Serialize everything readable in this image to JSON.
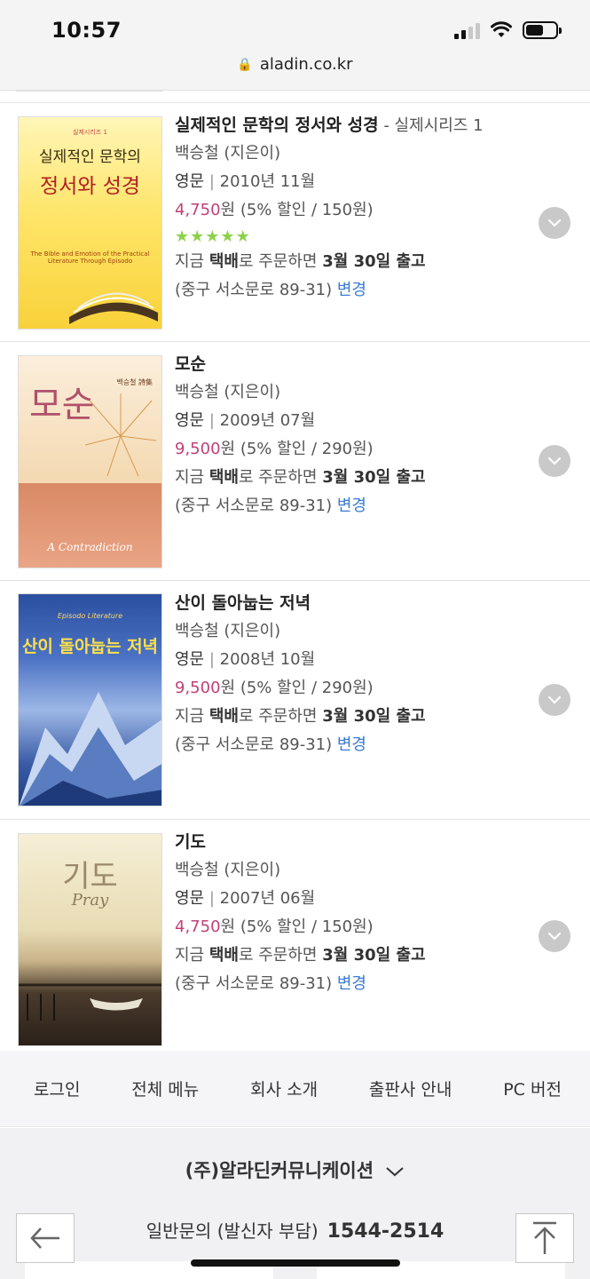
{
  "status_bar": {
    "time": "10:57"
  },
  "browser": {
    "url": "aladin.co.kr"
  },
  "books": [
    {
      "title": "실제적인 문학의 정서와 성경",
      "series": " - 실제시리즈 1",
      "author": "백승철",
      "role": " (지은이)",
      "publisher": "영문",
      "date": "2010년 11월",
      "price": "4,750",
      "price_unit": "원",
      "discount": " (5% 할인 / 150원)",
      "rating_stars": 5,
      "delivery_prefix": "지금 ",
      "delivery_method": "택배",
      "delivery_mid": "로 주문하면 ",
      "delivery_date": "3월 30일 출고",
      "address": "(중구 서소문로 89-31) ",
      "change_label": "변경",
      "cover": {
        "small": "실제시리즈 1",
        "line1": "실제적인 문학의",
        "line2": "정서와 성경",
        "sub": "The Bible and Emotion of the Practical Literature Through Episodo"
      }
    },
    {
      "title": "모순",
      "series": "",
      "author": "백승철",
      "role": " (지은이)",
      "publisher": "영문",
      "date": "2009년 07월",
      "price": "9,500",
      "price_unit": "원",
      "discount": " (5% 할인 / 290원)",
      "delivery_prefix": "지금 ",
      "delivery_method": "택배",
      "delivery_mid": "로 주문하면 ",
      "delivery_date": "3월 30일 출고",
      "address": "(중구 서소문로 89-31) ",
      "change_label": "변경",
      "cover": {
        "big": "모순",
        "small": "백승철 詩集",
        "sub": "A Contradiction"
      }
    },
    {
      "title": "산이 돌아눕는 저녁",
      "series": "",
      "author": "백승철",
      "role": " (지은이)",
      "publisher": "영문",
      "date": "2008년 10월",
      "price": "9,500",
      "price_unit": "원",
      "discount": " (5% 할인 / 290원)",
      "delivery_prefix": "지금 ",
      "delivery_method": "택배",
      "delivery_mid": "로 주문하면 ",
      "delivery_date": "3월 30일 출고",
      "address": "(중구 서소문로 89-31) ",
      "change_label": "변경",
      "cover": {
        "small": "Episodo Literature",
        "big": "산이 돌아눕는 저녁"
      }
    },
    {
      "title": "기도",
      "series": "",
      "author": "백승철",
      "role": " (지은이)",
      "publisher": "영문",
      "date": "2007년 06월",
      "price": "4,750",
      "price_unit": "원",
      "discount": " (5% 할인 / 150원)",
      "delivery_prefix": "지금 ",
      "delivery_method": "택배",
      "delivery_mid": "로 주문하면 ",
      "delivery_date": "3월 30일 출고",
      "address": "(중구 서소문로 89-31) ",
      "change_label": "변경",
      "cover": {
        "big": "기도",
        "sub": "Pray"
      }
    }
  ],
  "footer": {
    "menu": [
      "로그인",
      "전체 메뉴",
      "회사 소개",
      "출판사 안내",
      "PC 버전"
    ],
    "company": "(주)알라딘커뮤니케이션",
    "contact_label": "일반문의 (발신자 부담)",
    "contact_number": "1544-2514"
  },
  "colors": {
    "price": "#c0407a",
    "link": "#3a7bd5",
    "stars": "#8cd14a"
  }
}
